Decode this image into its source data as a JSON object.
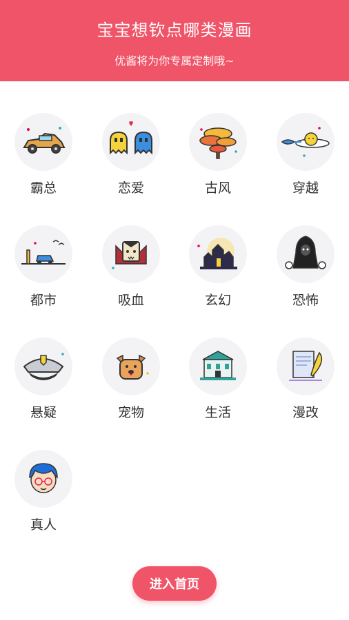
{
  "header": {
    "title": "宝宝想钦点哪类漫画",
    "subtitle": "优酱将为你专属定制哦~"
  },
  "categories": [
    {
      "label": "霸总",
      "icon": "sports-car-icon"
    },
    {
      "label": "恋爱",
      "icon": "ghost-couple-icon"
    },
    {
      "label": "古风",
      "icon": "ancient-tree-icon"
    },
    {
      "label": "穿越",
      "icon": "comet-icon"
    },
    {
      "label": "都市",
      "icon": "city-car-icon"
    },
    {
      "label": "吸血",
      "icon": "vampire-icon"
    },
    {
      "label": "玄幻",
      "icon": "haunted-castle-icon"
    },
    {
      "label": "恐怖",
      "icon": "grim-reaper-icon"
    },
    {
      "label": "悬疑",
      "icon": "police-cap-icon"
    },
    {
      "label": "宠物",
      "icon": "pet-dog-icon"
    },
    {
      "label": "生活",
      "icon": "building-icon"
    },
    {
      "label": "漫改",
      "icon": "quill-paper-icon"
    },
    {
      "label": "真人",
      "icon": "person-avatar-icon"
    }
  ],
  "enter_button": {
    "label": "进入首页"
  },
  "colors": {
    "accent": "#f05468",
    "circle_bg": "#f3f3f5"
  }
}
